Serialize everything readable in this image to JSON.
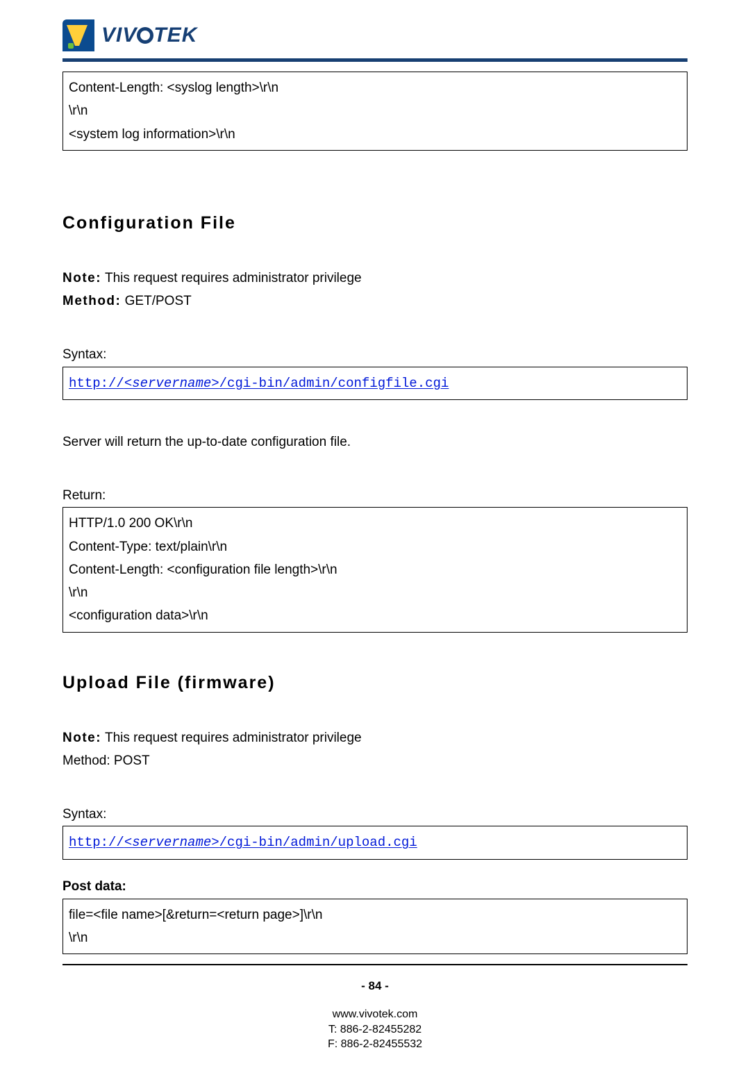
{
  "brand": {
    "name": "VIVOTEK"
  },
  "top_box": {
    "l1": "Content-Length: <syslog length>\\r\\n",
    "l2": "\\r\\n",
    "l3": "<system log information>\\r\\n"
  },
  "config": {
    "title": "Configuration File",
    "note_label": "Note:",
    "note_text": " This request requires administrator privilege",
    "method_label": "Method:",
    "method_value": " GET/POST",
    "syntax_label": "Syntax:",
    "url_prefix": "http://",
    "url_server": "<servername>",
    "url_path": "/cgi-bin/admin/configfile.cgi",
    "desc": "Server will return the up-to-date configuration file.",
    "return_label": "Return:",
    "ret": {
      "l1": "HTTP/1.0 200 OK\\r\\n",
      "l2": "Content-Type: text/plain\\r\\n",
      "l3": "Content-Length: <configuration file length>\\r\\n",
      "l4": "\\r\\n",
      "l5": "<configuration data>\\r\\n"
    }
  },
  "upload": {
    "title": "Upload File (firmware)",
    "note_label": "Note:",
    "note_text": " This request requires administrator privilege",
    "method_line": "Method: POST",
    "syntax_label": "Syntax:",
    "url_prefix": "http://",
    "url_server": "<servername>",
    "url_path": "/cgi-bin/admin/upload.cgi",
    "post_label": "Post data:",
    "post": {
      "l1": "file=<file name>[&return=<return page>]\\r\\n",
      "l2": "\\r\\n"
    }
  },
  "footer": {
    "page": "- 84 -",
    "site": "www.vivotek.com",
    "tel": "T: 886-2-82455282",
    "fax": "F: 886-2-82455532"
  }
}
